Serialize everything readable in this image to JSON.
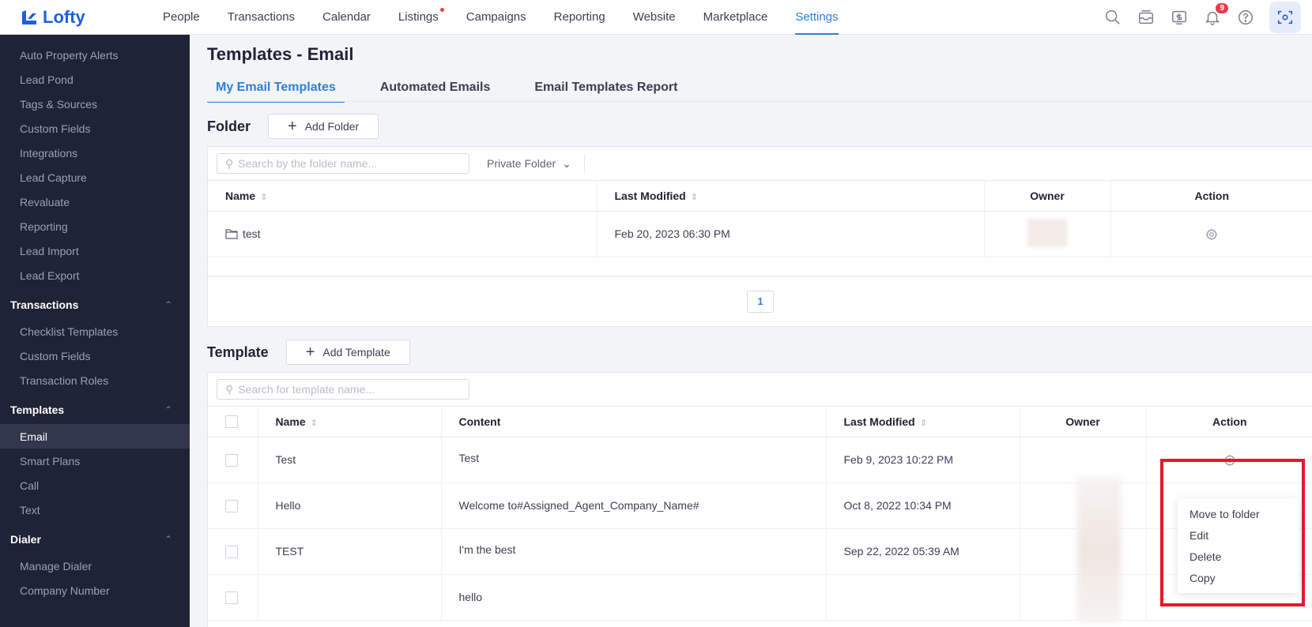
{
  "app": {
    "name": "Lofty"
  },
  "nav": {
    "items": [
      "People",
      "Transactions",
      "Calendar",
      "Listings",
      "Campaigns",
      "Reporting",
      "Website",
      "Marketplace",
      "Settings"
    ],
    "notification_count": "9"
  },
  "sidebar": {
    "group1_items": [
      "Auto Property Alerts",
      "Lead Pond",
      "Tags & Sources",
      "Custom Fields",
      "Integrations",
      "Lead Capture",
      "Revaluate",
      "Reporting",
      "Lead Import",
      "Lead Export"
    ],
    "transactions": {
      "label": "Transactions",
      "items": [
        "Checklist Templates",
        "Custom Fields",
        "Transaction Roles"
      ]
    },
    "templates": {
      "label": "Templates",
      "items": [
        "Email",
        "Smart Plans",
        "Call",
        "Text"
      ]
    },
    "dialer": {
      "label": "Dialer",
      "items": [
        "Manage Dialer",
        "Company Number"
      ]
    }
  },
  "page": {
    "title": "Templates - Email",
    "tabs": [
      "My Email Templates",
      "Automated Emails",
      "Email Templates Report"
    ]
  },
  "folder_section": {
    "title": "Folder",
    "add_label": "Add Folder",
    "search_placeholder": "Search by the folder name...",
    "filter_label": "Private Folder",
    "columns": {
      "name": "Name",
      "last_modified": "Last Modified",
      "owner": "Owner",
      "action": "Action"
    },
    "rows": [
      {
        "name": "test",
        "last_modified": "Feb 20, 2023 06:30 PM"
      }
    ],
    "page": "1"
  },
  "template_section": {
    "title": "Template",
    "add_label": "Add Template",
    "search_placeholder": "Search for template name...",
    "columns": {
      "name": "Name",
      "content": "Content",
      "last_modified": "Last Modified",
      "owner": "Owner",
      "action": "Action"
    },
    "rows": [
      {
        "name": "Test",
        "content": "Test",
        "last_modified": "Feb 9, 2023 10:22 PM"
      },
      {
        "name": "Hello",
        "content": "Welcome to#Assigned_Agent_Company_Name#",
        "last_modified": "Oct 8, 2022 10:34 PM"
      },
      {
        "name": "TEST",
        "content": "I'm the best",
        "last_modified": "Sep 22, 2022 05:39 AM"
      },
      {
        "name": "",
        "content": "hello",
        "last_modified": ""
      }
    ]
  },
  "action_menu": {
    "items": [
      "Move to folder",
      "Edit",
      "Delete",
      "Copy"
    ]
  },
  "colors": {
    "accent": "#2f80d6",
    "sidebar_bg": "#1f2336",
    "highlight": "#e8162a",
    "logo": "#1f5fdf"
  }
}
